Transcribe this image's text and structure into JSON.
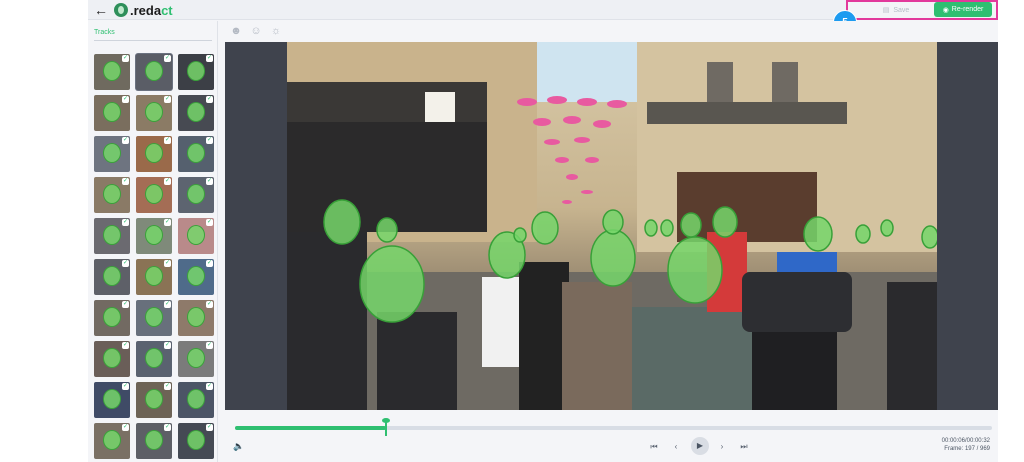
{
  "header": {
    "back_icon": "arrow-left-icon",
    "logo_part1": ".reda",
    "logo_part2": "ct",
    "save_label": "Save",
    "rerender_label": "Re-render",
    "step_badge": "5"
  },
  "sidebar": {
    "tracks_label": "Tracks",
    "thumb_count": 30,
    "thumbs": [
      {
        "bg": "#6f6a5f",
        "selected": false
      },
      {
        "bg": "#5a5d66",
        "selected": true
      },
      {
        "bg": "#3c3f46",
        "selected": false
      },
      {
        "bg": "#7a6e5e",
        "selected": false
      },
      {
        "bg": "#8b7b65",
        "selected": false
      },
      {
        "bg": "#474a52",
        "selected": false
      },
      {
        "bg": "#6e7480",
        "selected": false
      },
      {
        "bg": "#9a6a4a",
        "selected": false
      },
      {
        "bg": "#55606e",
        "selected": false
      },
      {
        "bg": "#8a7a66",
        "selected": false
      },
      {
        "bg": "#a46d55",
        "selected": false
      },
      {
        "bg": "#5d6470",
        "selected": false
      },
      {
        "bg": "#6b6a70",
        "selected": false
      },
      {
        "bg": "#7f8a7a",
        "selected": false
      },
      {
        "bg": "#b98a8a",
        "selected": false
      },
      {
        "bg": "#5e6068",
        "selected": false
      },
      {
        "bg": "#8a7355",
        "selected": false
      },
      {
        "bg": "#4f6b8a",
        "selected": false
      },
      {
        "bg": "#726a62",
        "selected": false
      },
      {
        "bg": "#68707c",
        "selected": false
      },
      {
        "bg": "#8e7a6a",
        "selected": false
      },
      {
        "bg": "#6a5e58",
        "selected": false
      },
      {
        "bg": "#5a6270",
        "selected": false
      },
      {
        "bg": "#7b7b7b",
        "selected": false
      },
      {
        "bg": "#3f4b66",
        "selected": false
      },
      {
        "bg": "#6d6356",
        "selected": false
      },
      {
        "bg": "#4c5566",
        "selected": false
      },
      {
        "bg": "#7a7064",
        "selected": false
      },
      {
        "bg": "#5d5f66",
        "selected": false
      },
      {
        "bg": "#454a54",
        "selected": false
      }
    ]
  },
  "toolbar": {
    "icons": [
      "face-person-icon",
      "mask-icon",
      "eye-slash-icon"
    ]
  },
  "player": {
    "progress": 0.2,
    "time": "00:00:06/00:00:32",
    "frame": "Frame: 197 / 969",
    "volume_icon": "volume-icon",
    "prev_icon": "skip-back-icon",
    "step_back_icon": "step-back-icon",
    "play_icon": "play-icon",
    "step_forward_icon": "step-forward-icon",
    "next_icon": "skip-forward-icon"
  },
  "colors": {
    "accent": "#2fbf71",
    "highlight": "#e2399b",
    "badge": "#1d9bf0",
    "face_blur": "#76d66a"
  }
}
